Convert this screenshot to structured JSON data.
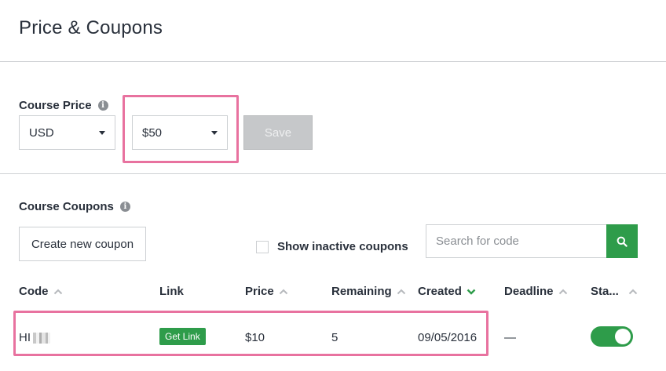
{
  "page": {
    "title": "Price & Coupons"
  },
  "price": {
    "label": "Course Price",
    "currency": "USD",
    "amount": "$50",
    "save_label": "Save"
  },
  "coupons": {
    "label": "Course Coupons",
    "create_label": "Create new coupon",
    "show_inactive_label": "Show inactive coupons",
    "search_placeholder": "Search for code",
    "columns": {
      "code": "Code",
      "link": "Link",
      "price": "Price",
      "remaining": "Remaining",
      "created": "Created",
      "deadline": "Deadline",
      "status": "Sta..."
    },
    "rows": [
      {
        "code": "HI",
        "link_label": "Get Link",
        "price": "$10",
        "remaining": "5",
        "created": "09/05/2016",
        "deadline": "—",
        "active": true
      }
    ]
  },
  "colors": {
    "accent_green": "#2e9c4a",
    "highlight_pink": "#e8729f"
  },
  "icons": {
    "info": "info-icon",
    "search": "search-icon",
    "sort_up": "chevron-up-icon",
    "sort_down": "chevron-down-icon",
    "caret": "caret-down-icon"
  }
}
